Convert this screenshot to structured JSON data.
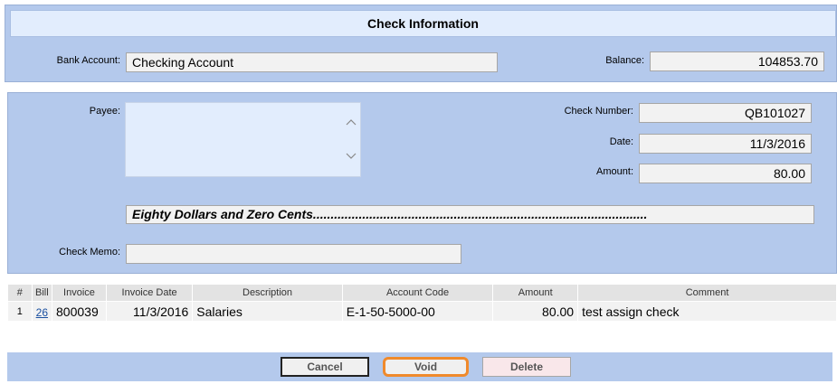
{
  "header": {
    "title": "Check Information"
  },
  "bank": {
    "account_label": "Bank Account:",
    "account_value": "Checking Account",
    "balance_label": "Balance:",
    "balance_value": "104853.70"
  },
  "check": {
    "payee_label": "Payee:",
    "payee_value": "",
    "number_label": "Check Number:",
    "number_value": "QB101027",
    "date_label": "Date:",
    "date_value": "11/3/2016",
    "amount_label": "Amount:",
    "amount_value": "80.00",
    "amount_words": "Eighty Dollars and Zero Cents...............................................................................................",
    "memo_label": "Check Memo:",
    "memo_value": ""
  },
  "table": {
    "columns": [
      "#",
      "Bill",
      "Invoice",
      "Invoice Date",
      "Description",
      "Account Code",
      "Amount",
      "Comment"
    ],
    "rows": [
      {
        "num": "1",
        "bill": "26",
        "invoice": "800039",
        "invoice_date": "11/3/2016",
        "description": "Salaries",
        "account_code": "E-1-50-5000-00",
        "amount": "80.00",
        "comment": "test assign check"
      }
    ]
  },
  "buttons": {
    "cancel": "Cancel",
    "void": "Void",
    "delete": "Delete"
  },
  "icons": {
    "scroll_up": "chevron-up-icon",
    "scroll_down": "chevron-down-icon"
  },
  "colors": {
    "panel": "#b4c9ec",
    "header": "#e2edfd",
    "highlight": "#f08a2c"
  }
}
